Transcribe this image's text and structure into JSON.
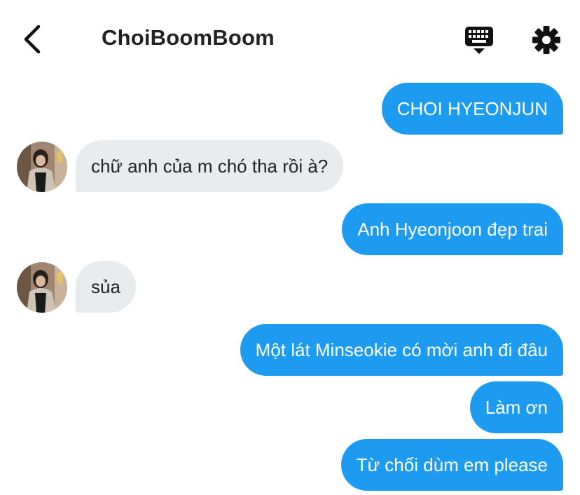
{
  "header": {
    "title": "ChoiBoomBoom",
    "back_icon": "chevron-left-icon",
    "keyboard_icon": "keyboard-icon",
    "settings_icon": "gear-icon"
  },
  "messages": [
    {
      "from": "me",
      "text": "CHOI HYEONJUN"
    },
    {
      "from": "them",
      "text": "chữ anh của m chó tha rồi à?"
    },
    {
      "from": "me",
      "text": "Anh Hyeonjoon đẹp trai"
    },
    {
      "from": "them",
      "text": "sủa"
    },
    {
      "from": "me",
      "text": "Một lát Minseokie có mời anh đi đâu"
    },
    {
      "from": "me",
      "text": "Làm ơn"
    },
    {
      "from": "me",
      "text": "Từ chối dùm em please"
    }
  ],
  "colors": {
    "sent_bubble": "#1d9bf0",
    "received_bubble": "#e9ecef",
    "text_dark": "#222222"
  }
}
